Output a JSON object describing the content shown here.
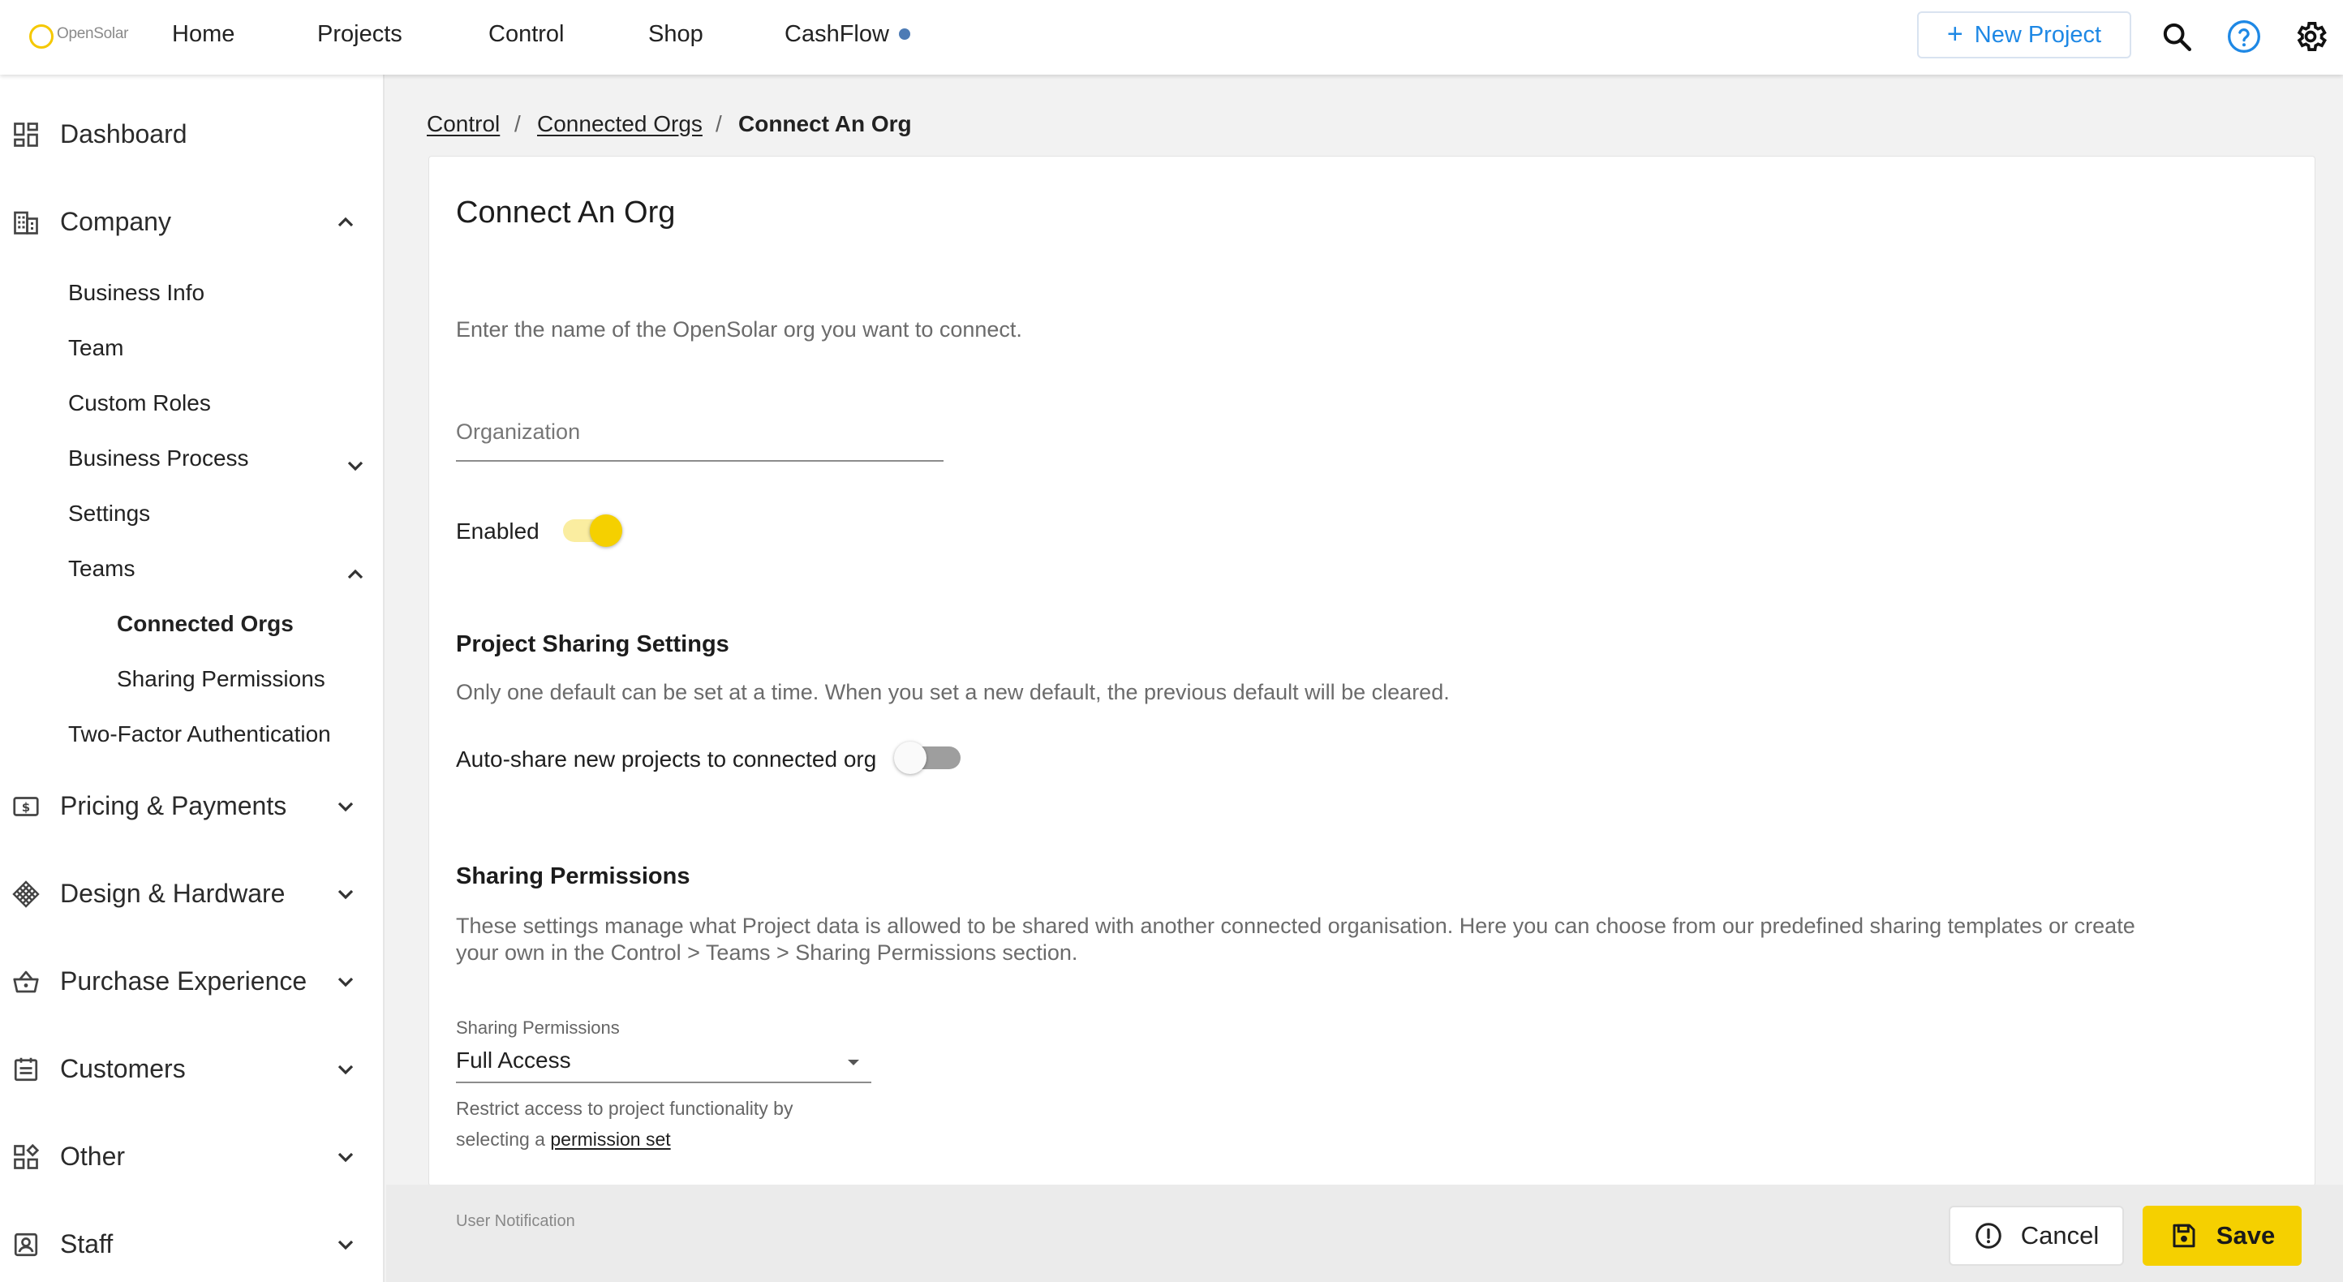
{
  "topbar": {
    "logo_text": "OpenSolar",
    "nav": {
      "home": "Home",
      "projects": "Projects",
      "control": "Control",
      "shop": "Shop",
      "cashflow": "CashFlow"
    },
    "new_project_label": "New Project",
    "icons": [
      "search-icon",
      "help-icon",
      "gear-icon"
    ]
  },
  "sidebar": {
    "dashboard": "Dashboard",
    "company": "Company",
    "company_items": {
      "business_info": "Business Info",
      "team": "Team",
      "custom_roles": "Custom Roles",
      "business_process": "Business Process",
      "settings": "Settings",
      "teams": "Teams",
      "connected_orgs": "Connected Orgs",
      "sharing_permissions": "Sharing Permissions",
      "two_factor": "Two-Factor Authentication"
    },
    "pricing": "Pricing & Payments",
    "design": "Design & Hardware",
    "purchase": "Purchase Experience",
    "customers": "Customers",
    "other": "Other",
    "staff": "Staff"
  },
  "breadcrumb": {
    "control": "Control",
    "sep": "/",
    "connected_orgs": "Connected Orgs",
    "current": "Connect An Org"
  },
  "form": {
    "title": "Connect An Org",
    "intro": "Enter the name of the OpenSolar org you want to connect.",
    "organization_placeholder": "Organization",
    "enabled_label": "Enabled",
    "enabled": true,
    "project_sharing": {
      "heading": "Project Sharing Settings",
      "description": "Only one default can be set at a time. When you set a new default, the previous default will be cleared.",
      "autoshare_label": "Auto-share new projects to connected org",
      "autoshare": false
    },
    "sharing_permissions": {
      "heading": "Sharing Permissions",
      "description_line1": "These settings manage what Project data is allowed to be shared with another connected organisation. Here you can choose from our predefined sharing templates or create",
      "description_line2": "your own in the Control > Teams > Sharing Permissions section.",
      "select_label": "Sharing Permissions",
      "select_value": "Full Access",
      "helper_line1": "Restrict access to project functionality by",
      "helper_prefix": "selecting a",
      "helper_link": "permission set"
    },
    "user_notification_label": "User Notification"
  },
  "footer": {
    "cancel_label": "Cancel",
    "save_label": "Save"
  },
  "colors": {
    "accent_yellow": "#f5d000",
    "link_blue": "#1e88e5",
    "cashflow_dot": "#4d7bb5"
  }
}
